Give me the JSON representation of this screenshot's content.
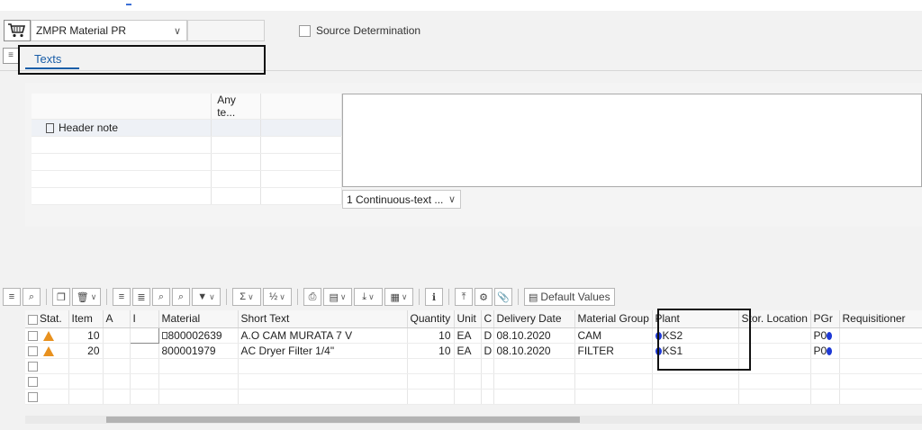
{
  "header": {
    "doc_type": "ZMPR Material PR",
    "source_determination": "Source Determination"
  },
  "tabs": [
    {
      "label": "Texts"
    }
  ],
  "texts_panel": {
    "column_header": "Any te...",
    "rows": [
      {
        "label": "Header note"
      }
    ],
    "format_select": "1 Continuous-text ..."
  },
  "toolbar": {
    "default_values": "Default Values"
  },
  "items": {
    "columns": [
      "Stat.",
      "Item",
      "A",
      "I",
      "Material",
      "Short Text",
      "Quantity",
      "Unit",
      "C",
      "Delivery Date",
      "Material Group",
      "Plant",
      "Stor. Location",
      "PGr",
      "Requisitioner"
    ],
    "rows": [
      {
        "item": "10",
        "material": "800002639",
        "short_text": "A.O CAM MURATA 7 V",
        "quantity": "10",
        "unit": "EA",
        "c": "D",
        "delivery_date": "08.10.2020",
        "material_group": "CAM",
        "plant": "KS2",
        "pgr": "P0"
      },
      {
        "item": "20",
        "material": "800001979",
        "short_text": "AC Dryer Filter 1/4\"",
        "quantity": "10",
        "unit": "EA",
        "c": "D",
        "delivery_date": "08.10.2020",
        "material_group": "FILTER",
        "plant": "KS1",
        "pgr": "P0"
      }
    ]
  },
  "colors": {
    "tab_accent": "#1a5ea8",
    "warning": "#e8911e",
    "redaction": "#1f3ad6"
  }
}
